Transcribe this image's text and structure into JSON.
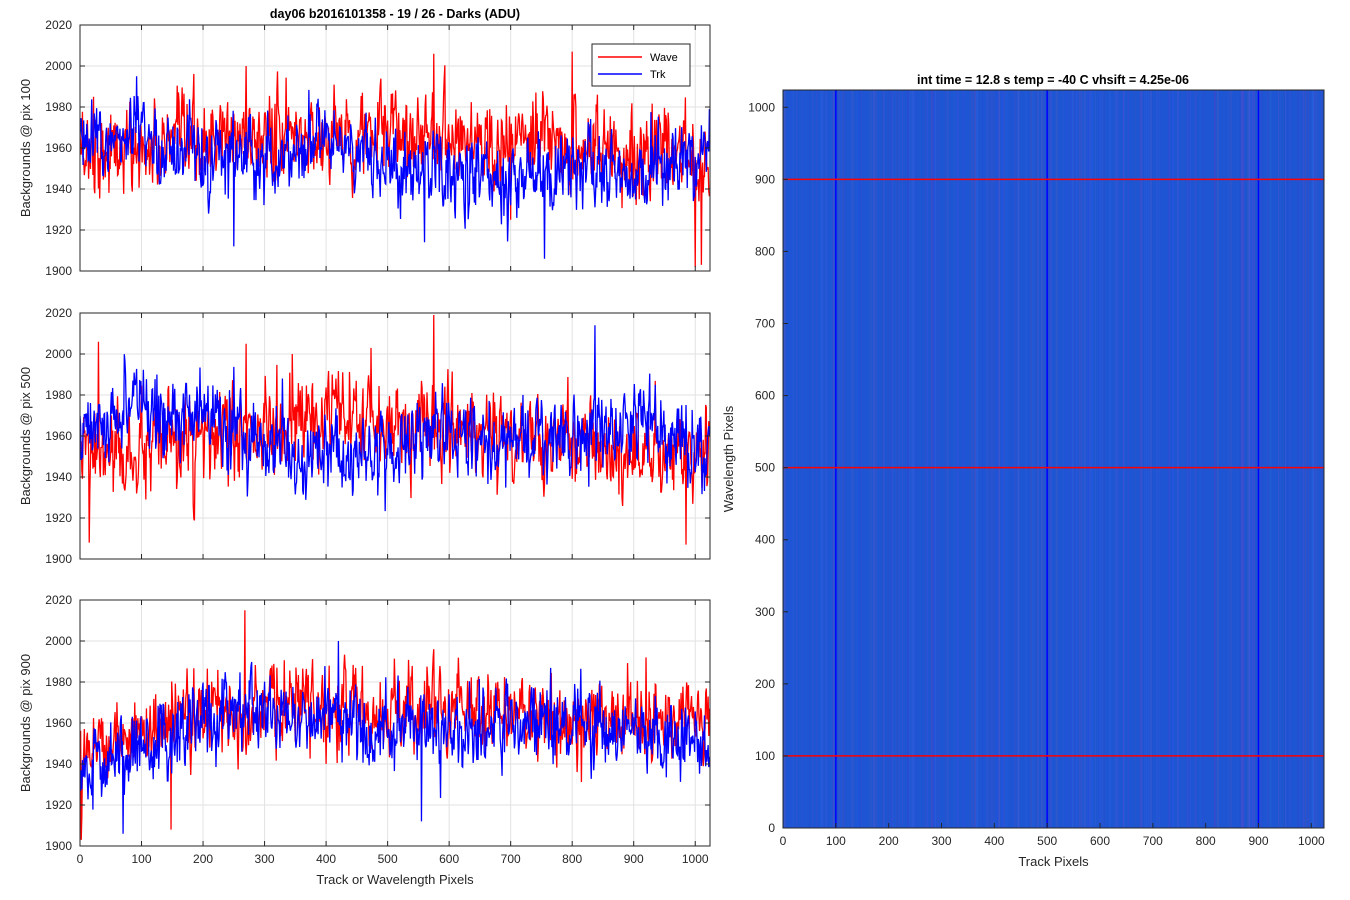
{
  "figure": {
    "left_title": "day06 b2016101358 - 19 / 26 - Darks (ADU)",
    "right_title": "int time = 12.8 s    temp = -40 C    vhsift = 4.25e-06"
  },
  "colors": {
    "wave": "#ff0000",
    "trk": "#0000ff",
    "image_base": "#1e55d2",
    "grid": "#e2e2e2"
  },
  "chart_data": [
    {
      "type": "line",
      "title": "day06 b2016101358 - 19 / 26 - Darks (ADU)",
      "xlabel": "",
      "ylabel": "Backgrounds @ pix 100",
      "xlim": [
        0,
        1024
      ],
      "ylim": [
        1900,
        2020
      ],
      "xticks": [
        0,
        100,
        200,
        300,
        400,
        500,
        600,
        700,
        800,
        900,
        1000
      ],
      "yticks": [
        1900,
        1920,
        1940,
        1960,
        1980,
        2000,
        2020
      ],
      "show_xtick_labels": false,
      "grid": true,
      "legend": {
        "position": "top-right",
        "entries": [
          "Wave",
          "Trk"
        ]
      },
      "series": [
        {
          "name": "Wave",
          "color": "#ff0000",
          "n_points": 1024,
          "profile": [
            [
              0,
              1960
            ],
            [
              100,
              1958
            ],
            [
              200,
              1962
            ],
            [
              300,
              1966
            ],
            [
              400,
              1966
            ],
            [
              500,
              1967
            ],
            [
              600,
              1968
            ],
            [
              700,
              1962
            ],
            [
              800,
              1962
            ],
            [
              900,
              1958
            ],
            [
              1024,
              1955
            ]
          ],
          "noise": 11,
          "spikes": [
            [
              22,
              1985
            ],
            [
              270,
              2000
            ],
            [
              575,
              2006
            ],
            [
              800,
              2007
            ],
            [
              1000,
              1902
            ],
            [
              1010,
              1903
            ],
            [
              700,
              1925
            ]
          ]
        },
        {
          "name": "Trk",
          "color": "#0000ff",
          "n_points": 1024,
          "profile": [
            [
              0,
              1962
            ],
            [
              100,
              1966
            ],
            [
              200,
              1955
            ],
            [
              300,
              1955
            ],
            [
              400,
              1965
            ],
            [
              500,
              1950
            ],
            [
              600,
              1950
            ],
            [
              700,
              1945
            ],
            [
              800,
              1950
            ],
            [
              900,
              1948
            ],
            [
              1024,
              1958
            ]
          ],
          "noise": 10,
          "spikes": [
            [
              92,
              1995
            ],
            [
              560,
              1914
            ],
            [
              755,
              1906
            ],
            [
              250,
              1912
            ]
          ]
        }
      ]
    },
    {
      "type": "line",
      "title": "",
      "xlabel": "",
      "ylabel": "Backgrounds @ pix 500",
      "xlim": [
        0,
        1024
      ],
      "ylim": [
        1900,
        2020
      ],
      "xticks": [
        0,
        100,
        200,
        300,
        400,
        500,
        600,
        700,
        800,
        900,
        1000
      ],
      "yticks": [
        1900,
        1920,
        1940,
        1960,
        1980,
        2000,
        2020
      ],
      "show_xtick_labels": false,
      "grid": true,
      "series": [
        {
          "name": "Wave",
          "color": "#ff0000",
          "n_points": 1024,
          "profile": [
            [
              0,
              1950
            ],
            [
              100,
              1950
            ],
            [
              200,
              1958
            ],
            [
              300,
              1962
            ],
            [
              400,
              1968
            ],
            [
              500,
              1966
            ],
            [
              600,
              1965
            ],
            [
              700,
              1960
            ],
            [
              800,
              1958
            ],
            [
              900,
              1950
            ],
            [
              1024,
              1952
            ]
          ],
          "noise": 11,
          "spikes": [
            [
              30,
              2006
            ],
            [
              270,
              2005
            ],
            [
              575,
              2019
            ],
            [
              345,
              2000
            ],
            [
              15,
              1908
            ],
            [
              985,
              1907
            ]
          ]
        },
        {
          "name": "Trk",
          "color": "#0000ff",
          "n_points": 1024,
          "profile": [
            [
              0,
              1962
            ],
            [
              100,
              1975
            ],
            [
              200,
              1970
            ],
            [
              300,
              1955
            ],
            [
              400,
              1950
            ],
            [
              500,
              1952
            ],
            [
              600,
              1962
            ],
            [
              700,
              1955
            ],
            [
              800,
              1958
            ],
            [
              900,
              1965
            ],
            [
              1024,
              1952
            ]
          ],
          "noise": 10,
          "spikes": [
            [
              837,
              2014
            ],
            [
              125,
              1990
            ]
          ]
        }
      ]
    },
    {
      "type": "line",
      "title": "",
      "xlabel": "Track or Wavelength Pixels",
      "ylabel": "Backgrounds @ pix 900",
      "xlim": [
        0,
        1024
      ],
      "ylim": [
        1900,
        2020
      ],
      "xticks": [
        0,
        100,
        200,
        300,
        400,
        500,
        600,
        700,
        800,
        900,
        1000
      ],
      "yticks": [
        1900,
        1920,
        1940,
        1960,
        1980,
        2000,
        2020
      ],
      "show_xtick_labels": true,
      "grid": true,
      "series": [
        {
          "name": "Wave",
          "color": "#ff0000",
          "n_points": 1024,
          "profile": [
            [
              0,
              1950
            ],
            [
              100,
              1955
            ],
            [
              200,
              1965
            ],
            [
              300,
              1968
            ],
            [
              400,
              1968
            ],
            [
              500,
              1965
            ],
            [
              600,
              1968
            ],
            [
              700,
              1965
            ],
            [
              800,
              1962
            ],
            [
              900,
              1962
            ],
            [
              1024,
              1960
            ]
          ],
          "noise": 10,
          "spikes": [
            [
              268,
              2015
            ],
            [
              575,
              1996
            ],
            [
              920,
              1992
            ],
            [
              148,
              1908
            ],
            [
              2,
              1903
            ]
          ]
        },
        {
          "name": "Trk",
          "color": "#0000ff",
          "n_points": 1024,
          "profile": [
            [
              0,
              1935
            ],
            [
              100,
              1950
            ],
            [
              200,
              1962
            ],
            [
              300,
              1965
            ],
            [
              400,
              1962
            ],
            [
              500,
              1955
            ],
            [
              600,
              1955
            ],
            [
              700,
              1960
            ],
            [
              800,
              1960
            ],
            [
              900,
              1955
            ],
            [
              1024,
              1952
            ]
          ],
          "noise": 10,
          "spikes": [
            [
              420,
              2000
            ],
            [
              70,
              1906
            ],
            [
              555,
              1912
            ]
          ]
        }
      ]
    },
    {
      "type": "heatmap",
      "title": "int time = 12.8 s    temp = -40 C    vhsift = 4.25e-06",
      "xlabel": "Track Pixels",
      "ylabel": "Wavelength Pixels",
      "xlim": [
        0,
        1024
      ],
      "ylim": [
        0,
        1024
      ],
      "xticks": [
        0,
        100,
        200,
        300,
        400,
        500,
        600,
        700,
        800,
        900,
        1000
      ],
      "yticks": [
        0,
        100,
        200,
        300,
        400,
        500,
        600,
        700,
        800,
        900,
        1000
      ],
      "marker_lines": {
        "vertical_x": [
          100,
          500,
          900
        ],
        "vertical_color": "#0000ff",
        "horizontal_y": [
          100,
          500,
          900
        ],
        "horizontal_color": "#ff0000"
      }
    }
  ]
}
